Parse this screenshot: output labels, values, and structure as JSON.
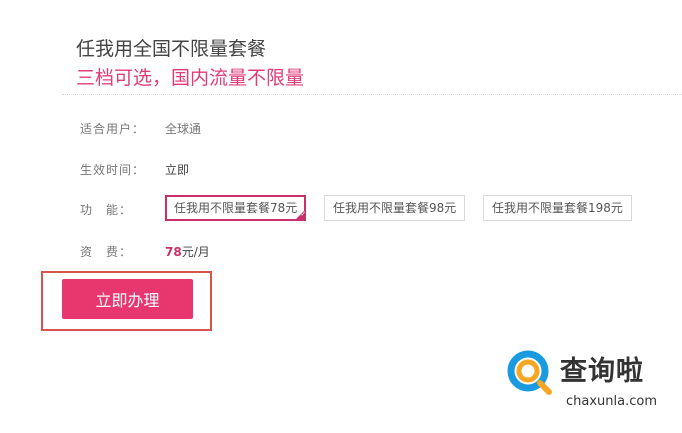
{
  "header": {
    "title": "任我用全国不限量套餐",
    "subtitle": "三档可选，国内流量不限量"
  },
  "details": {
    "users_label": "适合用户：",
    "users_value": "全球通",
    "effective_label": "生效时间：",
    "effective_value": "立即",
    "function_label": "功　能：",
    "fee_label": "资　费：",
    "fee_amount": "78",
    "fee_unit": "元/月"
  },
  "options": [
    {
      "label": "任我用不限量套餐78元",
      "selected": true
    },
    {
      "label": "任我用不限量套餐98元",
      "selected": false
    },
    {
      "label": "任我用不限量套餐198元",
      "selected": false
    }
  ],
  "cta": {
    "label": "立即办理"
  },
  "watermark": {
    "cn": "查询啦",
    "en": "chaxunla.com"
  },
  "colors": {
    "accent": "#e8376f",
    "selected_border": "#c8306a",
    "highlight_box": "#d9534f"
  }
}
